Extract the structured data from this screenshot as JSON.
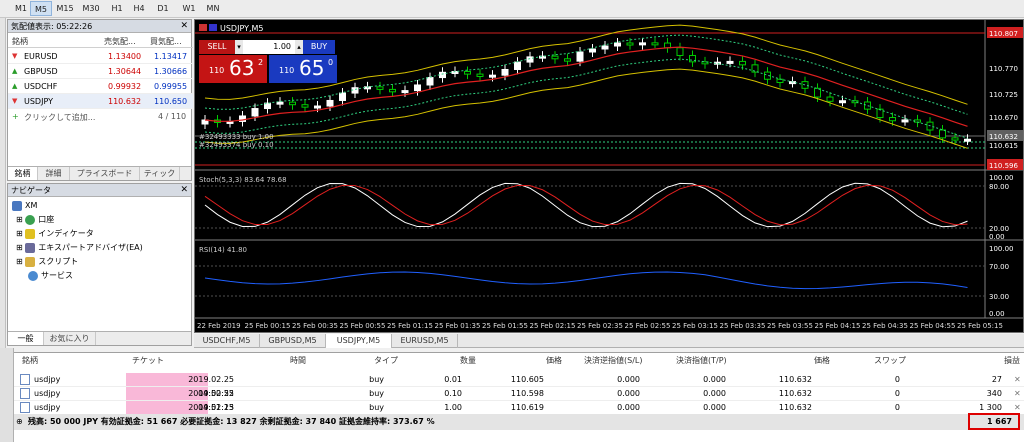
{
  "timeframes": [
    "M1",
    "M5",
    "M15",
    "M30",
    "H1",
    "H4",
    "D1",
    "W1",
    "MN"
  ],
  "active_timeframe": "M5",
  "market_watch": {
    "title": "気配値表示: 05:22:26",
    "columns": [
      "銘柄",
      "売気配...",
      "買気配..."
    ],
    "rows": [
      {
        "symbol": "EURUSD",
        "bid": "1.13400",
        "ask": "1.13417",
        "dir": "down"
      },
      {
        "symbol": "GBPUSD",
        "bid": "1.30644",
        "ask": "1.30666",
        "dir": "up"
      },
      {
        "symbol": "USDCHF",
        "bid": "0.99932",
        "ask": "0.99955",
        "dir": "up"
      },
      {
        "symbol": "USDJPY",
        "bid": "110.632",
        "ask": "110.650",
        "dir": "down"
      }
    ],
    "add_label": "クリックして追加...",
    "count": "4 / 110",
    "tabs": [
      "銘柄",
      "詳細",
      "プライスボード",
      "ティック"
    ]
  },
  "navigator": {
    "title": "ナビゲータ",
    "items": [
      "XM",
      "口座",
      "インディケータ",
      "エキスパートアドバイザ(EA)",
      "スクリプト",
      "サービス"
    ],
    "tabs": [
      "一般",
      "お気に入り"
    ]
  },
  "chart": {
    "title": "USDJPY,M5",
    "sell_label": "SELL",
    "buy_label": "BUY",
    "lot": "1.00",
    "sell_big": "110",
    "sell_price": "63",
    "sell_sup": "2",
    "buy_big": "110",
    "buy_price": "65",
    "buy_sup": "0",
    "price_labels": [
      "110.807",
      "110.770",
      "110.725",
      "110.670",
      "110.632",
      "110.615",
      "110.596"
    ],
    "stoch_label": "Stoch(5,3,3) 83.64 78.68",
    "stoch_levels": [
      "100.00",
      "80.00",
      "20.00",
      "0.00"
    ],
    "rsi_label": "RSI(14) 41.80",
    "rsi_levels": [
      "100.00",
      "70.00",
      "30.00",
      "0.00"
    ],
    "time_labels": [
      "22 Feb 2019",
      "25 Feb 00:15",
      "25 Feb 00:35",
      "25 Feb 00:55",
      "25 Feb 01:15",
      "25 Feb 01:35",
      "25 Feb 01:55",
      "25 Feb 02:15",
      "25 Feb 02:35",
      "25 Feb 02:55",
      "25 Feb 03:15",
      "25 Feb 03:35",
      "25 Feb 03:55",
      "25 Feb 04:15",
      "25 Feb 04:35",
      "25 Feb 04:55",
      "25 Feb 05:15"
    ],
    "order_line1": "#32493333 buy 1.00",
    "order_line2": "#32493374 buy 0.10"
  },
  "chart_tabs": [
    "USDCHF,M5",
    "GBPUSD,M5",
    "USDJPY,M5",
    "EURUSD,M5"
  ],
  "terminal": {
    "columns": [
      "銘柄",
      "チケット",
      "時間",
      "タイプ",
      "数量",
      "価格",
      "決済逆指値(S/L)",
      "決済指値(T/P)",
      "価格",
      "スワップ",
      "損益"
    ],
    "rows": [
      {
        "symbol": "usdjpy",
        "time": "2019.02.25 04:50:52",
        "type": "buy",
        "volume": "0.01",
        "price": "110.605",
        "sl": "0.000",
        "tp": "0.000",
        "cur": "110.632",
        "swap": "0",
        "profit": "27"
      },
      {
        "symbol": "usdjpy",
        "time": "2019.02.25 04:51:13",
        "type": "buy",
        "volume": "0.10",
        "price": "110.598",
        "sl": "0.000",
        "tp": "0.000",
        "cur": "110.632",
        "swap": "0",
        "profit": "340"
      },
      {
        "symbol": "usdjpy",
        "time": "2019.02.25 04:52:00",
        "type": "buy",
        "volume": "1.00",
        "price": "110.619",
        "sl": "0.000",
        "tp": "0.000",
        "cur": "110.632",
        "swap": "0",
        "profit": "1 300"
      }
    ],
    "balance": "残高: 50 000 JPY  有効証拠金: 51 667  必要証拠金: 13 827  余剰証拠金: 37 840  証拠金維持率: 373.67 %",
    "total": "1 667"
  },
  "colors": {
    "bull": "#ffffff",
    "bear": "#00c000",
    "price_line": "#ff3030",
    "stoch_main": "#ffffff",
    "stoch_signal": "#e02020",
    "rsi": "#2060ff",
    "ma_yellow": "#d4c000",
    "ma_red": "#e02020",
    "bb_dash": "#30d080"
  }
}
